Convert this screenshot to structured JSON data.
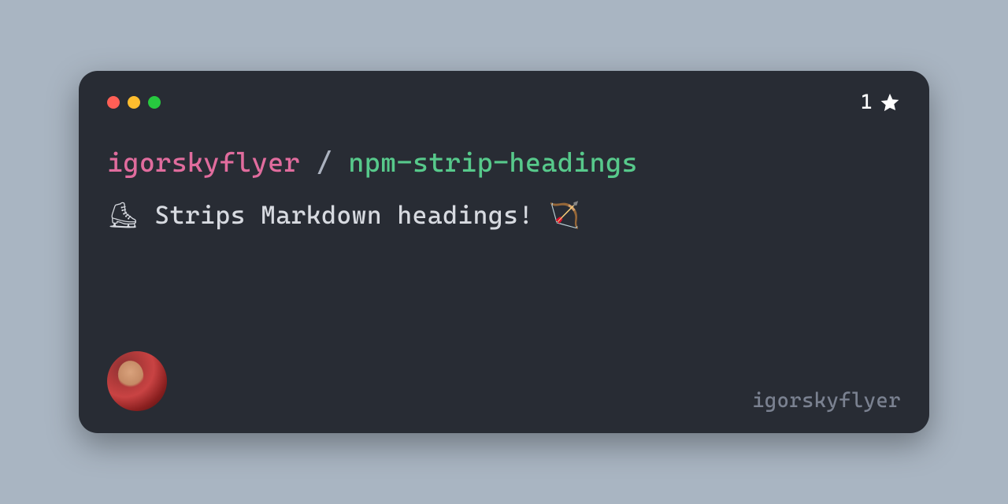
{
  "stars": "1",
  "owner": "igorskyflyer",
  "separator": "/",
  "repo": "npm-strip-headings",
  "description": "⛸ Strips Markdown headings! 🏹",
  "handle": "igorskyflyer",
  "colors": {
    "card_bg": "#282c34",
    "page_bg": "#a9b5c2",
    "owner": "#e06c9d",
    "repo": "#57c98b",
    "separator": "#abb2bf",
    "description": "#d7dae0",
    "handle": "#7a8190",
    "traffic_red": "#ff5f56",
    "traffic_yellow": "#ffbd2e",
    "traffic_green": "#27c93f"
  }
}
